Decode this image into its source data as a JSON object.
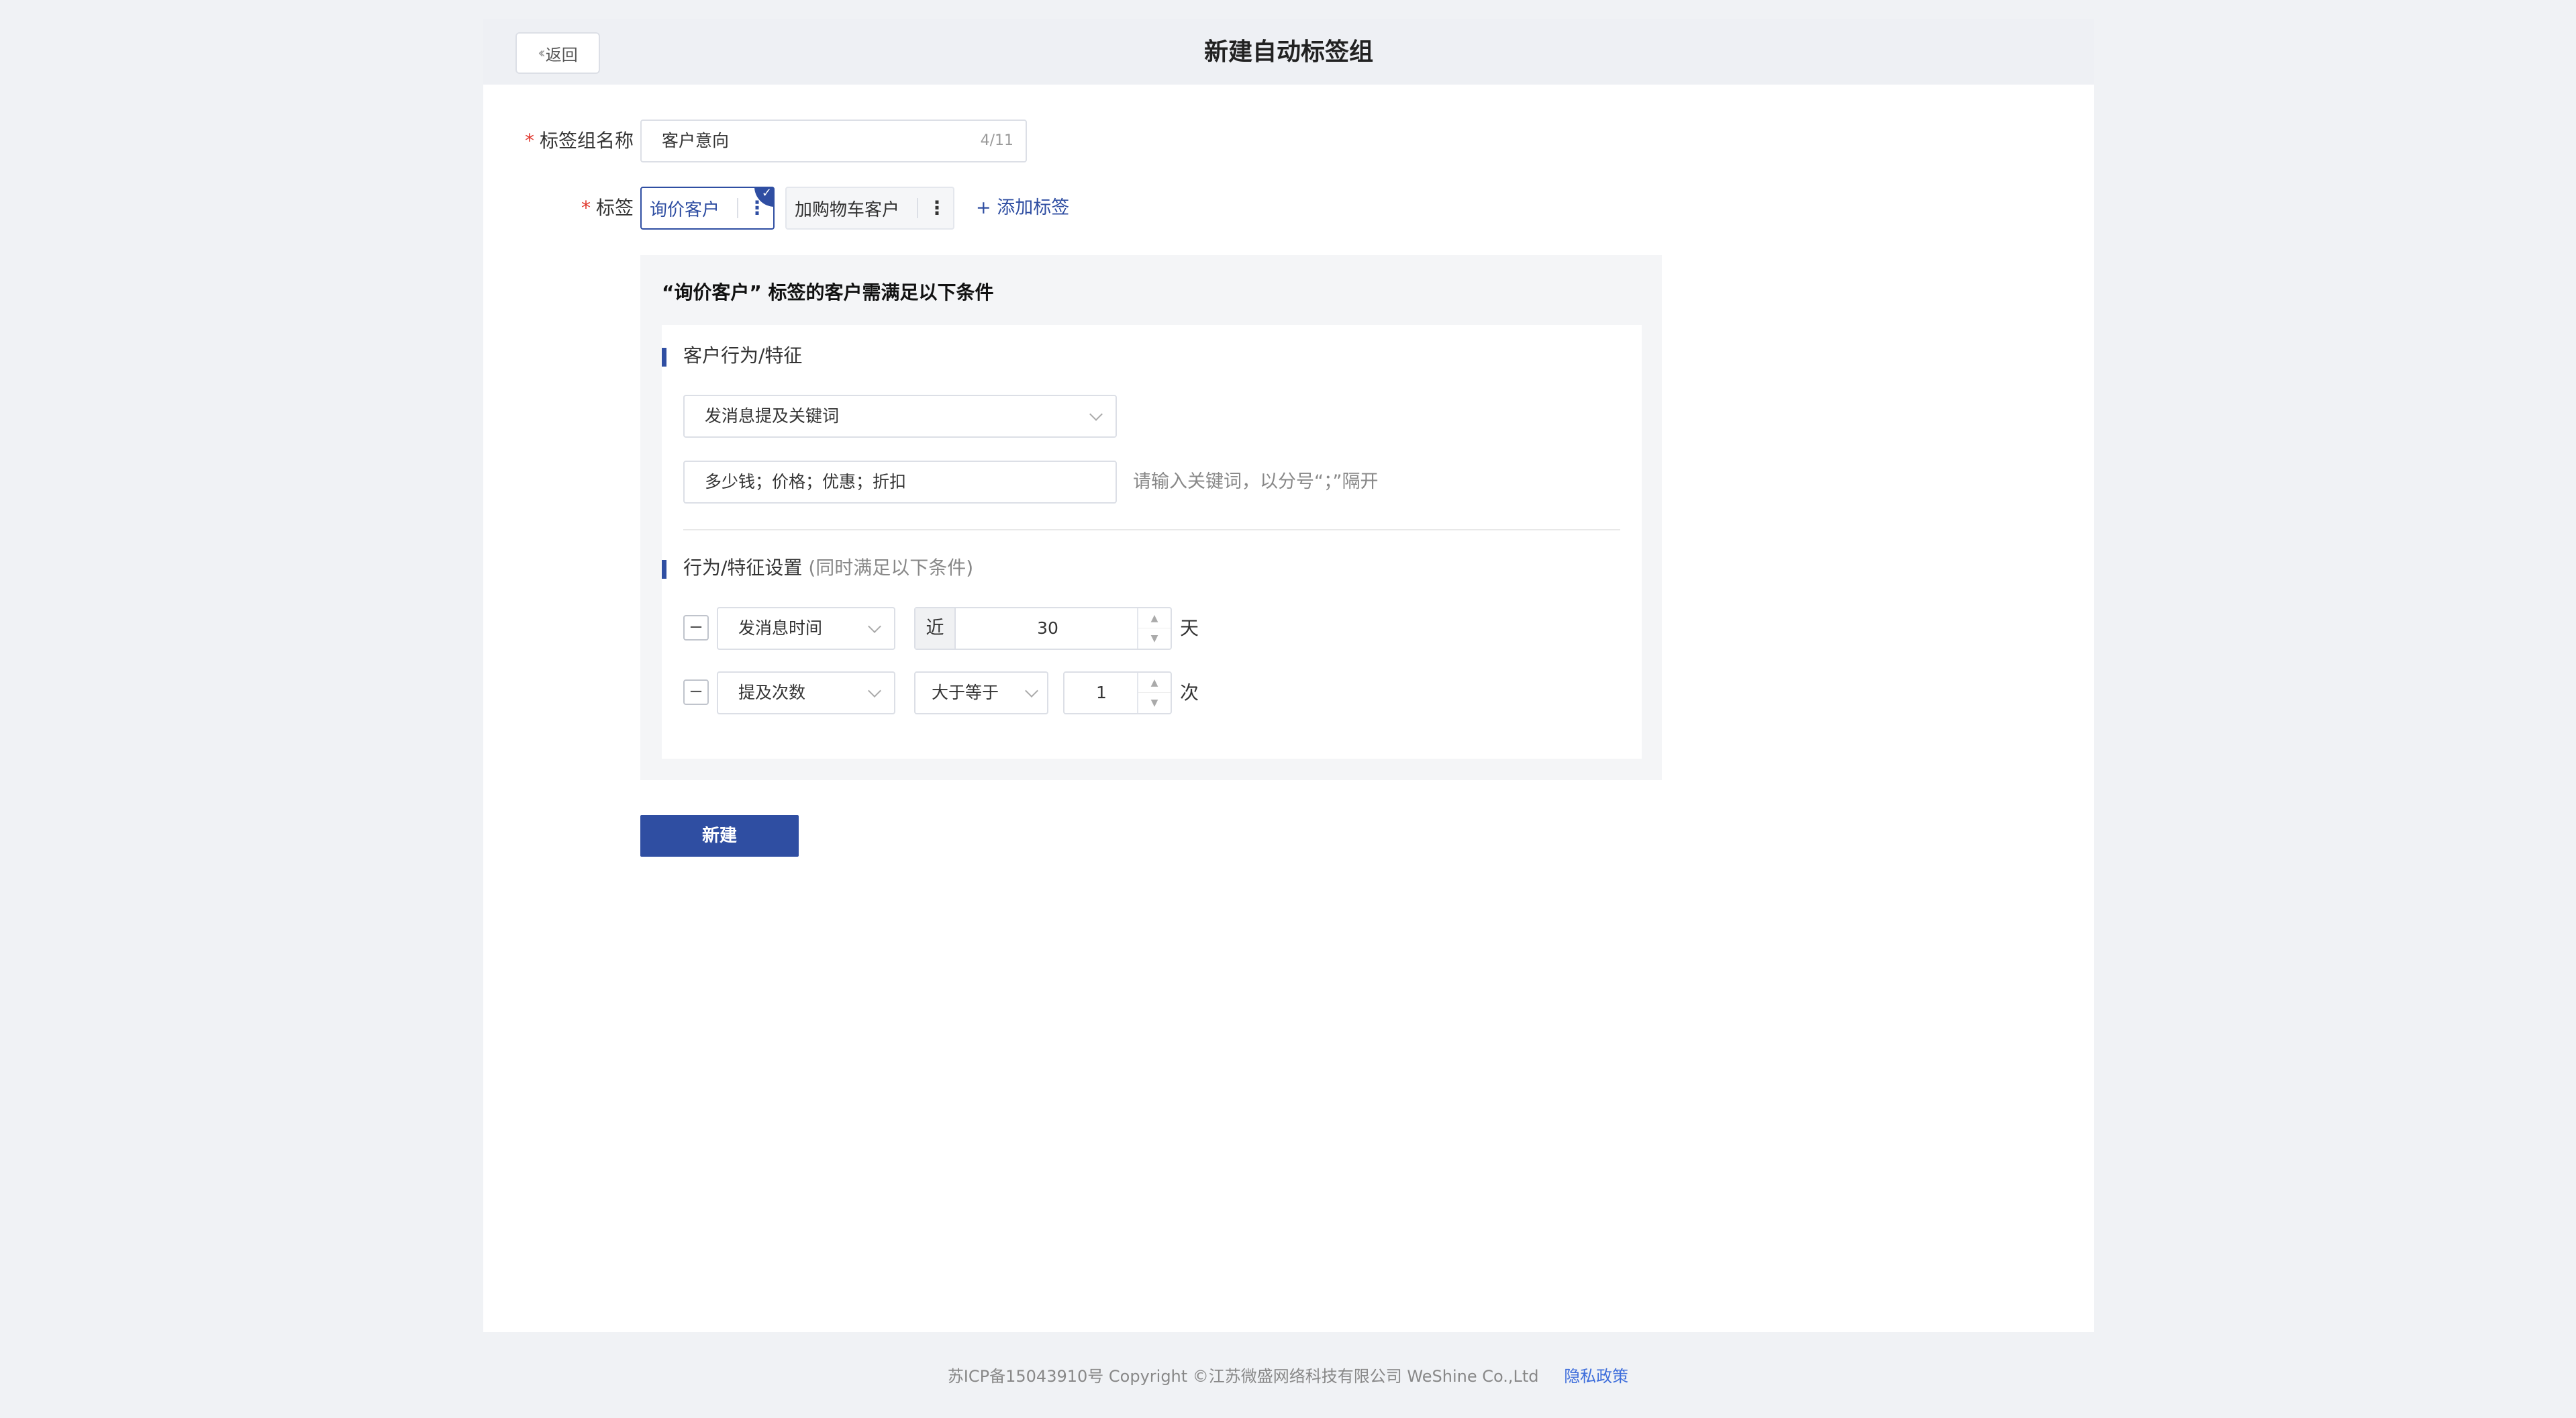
{
  "header": {
    "back_label": "返回",
    "title": "新建自动标签组"
  },
  "form": {
    "required_mark": "*",
    "name_label": "标签组名称",
    "name_value": "客户意向",
    "name_count": "4/11",
    "tags_label": "标签",
    "tags": [
      {
        "label": "询价客户",
        "active": true
      },
      {
        "label": "加购物车客户",
        "active": false
      }
    ],
    "add_tag_label": "+ 添加标签"
  },
  "condition": {
    "title": "“询价客户” 标签的客户需满足以下条件",
    "behavior_section_title": "客户行为/特征",
    "behavior_select": "发消息提及关键词",
    "keywords_value": "多少钱；价格；优惠；折扣",
    "keywords_hint": "请输入关键词，以分号“；”隔开",
    "settings_section_title": "行为/特征设置",
    "settings_section_hint": "(同时满足以下条件)",
    "rows": [
      {
        "field": "发消息时间",
        "prefix": "近",
        "value": "30",
        "unit": "天"
      },
      {
        "field": "提及次数",
        "operator": "大于等于",
        "value": "1",
        "unit": "次"
      }
    ]
  },
  "actions": {
    "create_label": "新建"
  },
  "footer": {
    "copyright": "苏ICP备15043910号 Copyright ©江苏微盛网络科技有限公司 WeShine Co.,Ltd",
    "privacy_label": "隐私政策"
  },
  "colors": {
    "primary": "#2f4ea2",
    "required": "#e0352b",
    "link": "#3d6ddb"
  }
}
